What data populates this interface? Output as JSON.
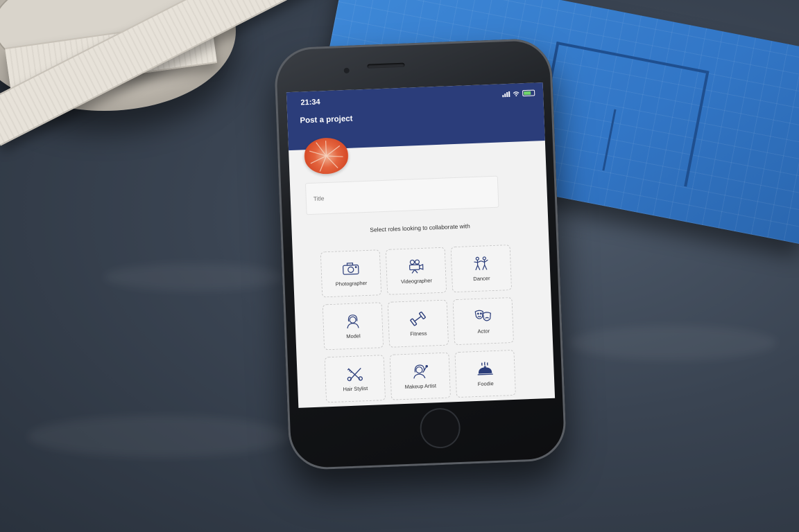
{
  "status_bar": {
    "time": "21:34"
  },
  "header": {
    "title": "Post a project"
  },
  "form": {
    "title_placeholder": "Title",
    "roles_prompt": "Select roles looking to collaborate with"
  },
  "roles": [
    {
      "label": "Photographer",
      "icon": "camera-icon"
    },
    {
      "label": "Videographer",
      "icon": "video-camera-icon"
    },
    {
      "label": "Dancer",
      "icon": "dancers-icon"
    },
    {
      "label": "Model",
      "icon": "model-icon"
    },
    {
      "label": "Fitness",
      "icon": "dumbbell-icon"
    },
    {
      "label": "Actor",
      "icon": "theater-masks-icon"
    },
    {
      "label": "Hair Stylist",
      "icon": "scissors-comb-icon"
    },
    {
      "label": "Makeup Artist",
      "icon": "makeup-artist-icon"
    },
    {
      "label": "Foodie",
      "icon": "cloche-icon"
    }
  ],
  "colors": {
    "header_bg": "#2b3d7a",
    "screen_bg": "#f2f2f2",
    "icon_stroke": "#2b3d7a",
    "avatar_orange": "#e4653f"
  }
}
